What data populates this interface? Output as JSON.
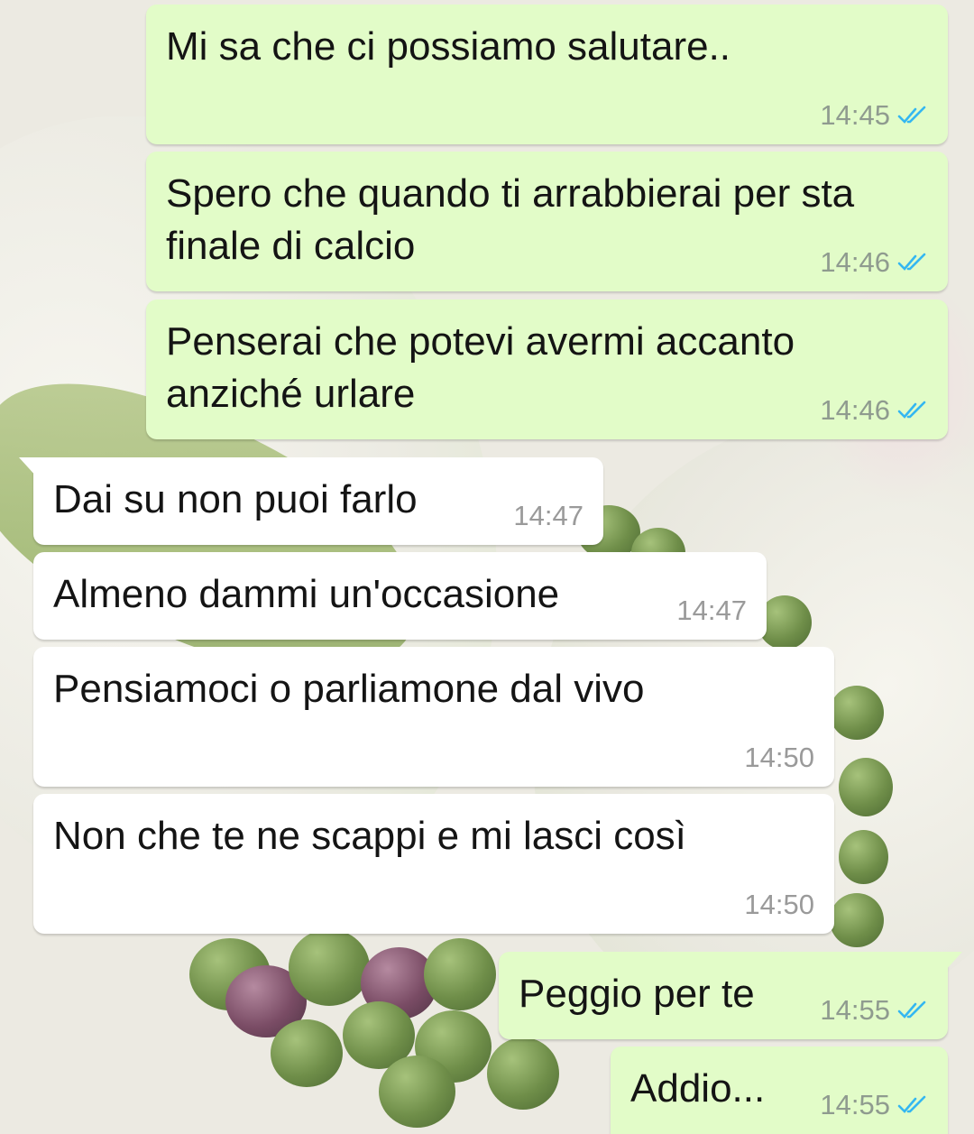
{
  "colors": {
    "outgoing_bubble": "#e2fcc8",
    "incoming_bubble": "#ffffff",
    "read_ticks": "#34b7f1",
    "timestamp": "#8f9b8f"
  },
  "icons": {
    "read_receipt": "double-check-icon"
  },
  "messages": [
    {
      "direction": "outgoing",
      "text": "Mi sa che ci possiamo salutare..",
      "time": "14:45",
      "status": "read"
    },
    {
      "direction": "outgoing",
      "text": "Spero che quando ti arrabbierai per sta\nfinale di calcio",
      "time": "14:46",
      "status": "read"
    },
    {
      "direction": "outgoing",
      "text": "Penserai che potevi avermi accanto\nanziché urlare",
      "time": "14:46",
      "status": "read"
    },
    {
      "direction": "incoming",
      "text": "Dai su non puoi farlo",
      "time": "14:47"
    },
    {
      "direction": "incoming",
      "text": "Almeno dammi un'occasione",
      "time": "14:47"
    },
    {
      "direction": "incoming",
      "text": "Pensiamoci o parliamone dal vivo",
      "time": "14:50"
    },
    {
      "direction": "incoming",
      "text": "Non che te ne scappi e mi lasci così",
      "time": "14:50"
    },
    {
      "direction": "outgoing",
      "text": "Peggio per te",
      "time": "14:55",
      "status": "read"
    },
    {
      "direction": "outgoing",
      "text": "Addio...",
      "time": "14:55",
      "status": "read"
    }
  ]
}
